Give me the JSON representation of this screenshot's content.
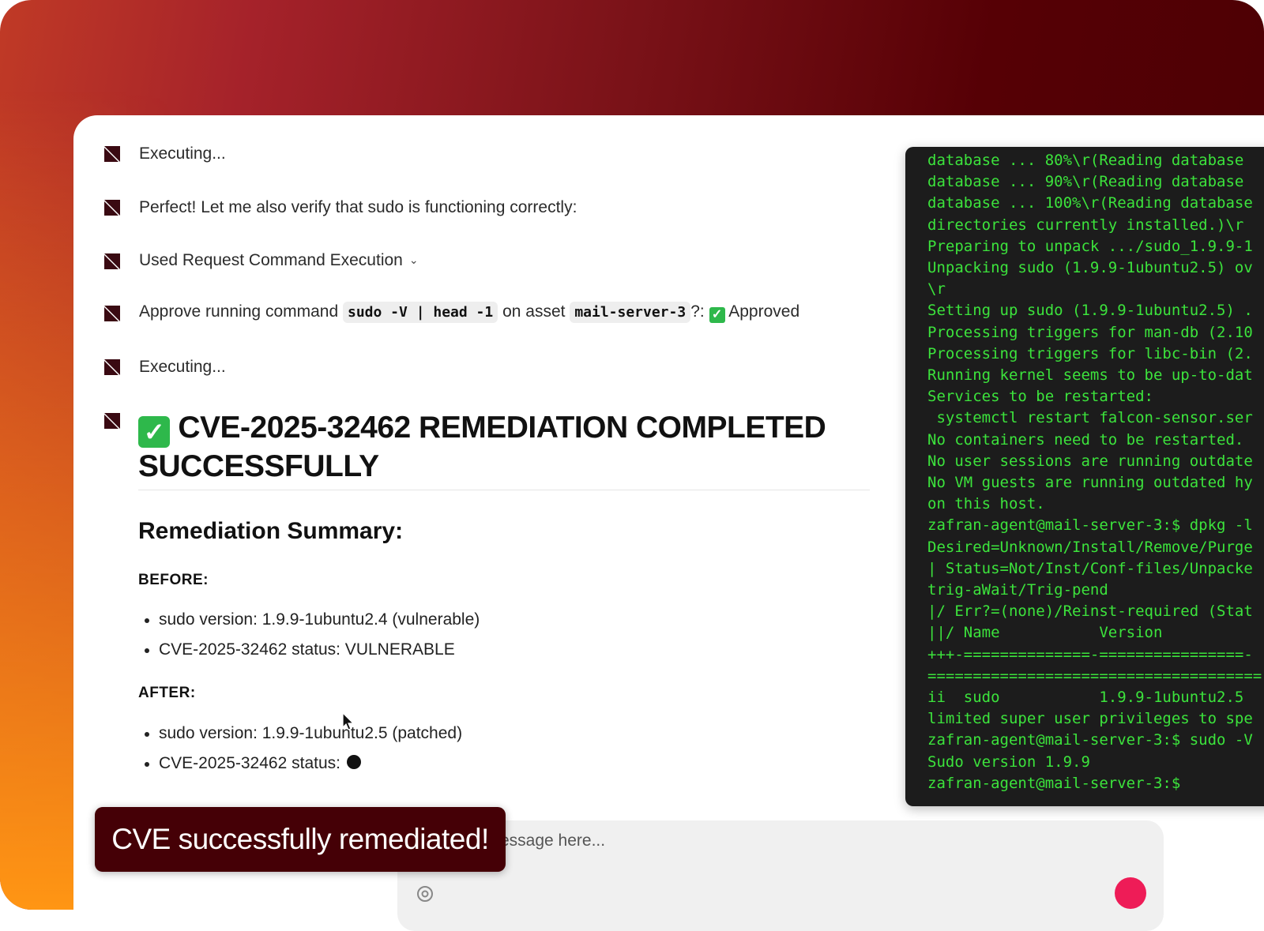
{
  "chat": {
    "messages": [
      {
        "text": "Executing..."
      },
      {
        "text": "Perfect! Let me also verify that sudo is functioning correctly:"
      },
      {
        "text": "Used Request Command Execution"
      },
      {
        "prefix": "Approve running command",
        "command": "sudo -V | head -1",
        "middle": "on asset",
        "asset": "mail-server-3",
        "suffix": "?:",
        "status": "Approved"
      },
      {
        "text": "Executing..."
      }
    ],
    "heading": "CVE-2025-32462 REMEDIATION COMPLETED SUCCESSFULLY",
    "summary_title": "Remediation Summary:",
    "before_label": "BEFORE:",
    "before_items": [
      "sudo version: 1.9.9-1ubuntu2.4 (vulnerable)",
      "CVE-2025-32462 status: VULNERABLE"
    ],
    "after_label": "AFTER:",
    "after_items": [
      "sudo version: 1.9.9-1ubuntu2.5 (patched)",
      "CVE-2025-32462 status:"
    ]
  },
  "terminal": {
    "lines": [
      "database ... 80%\\r(Reading database",
      "database ... 90%\\r(Reading database",
      "database ... 100%\\r(Reading database",
      "directories currently installed.)\\r",
      "Preparing to unpack .../sudo_1.9.9-1",
      "Unpacking sudo (1.9.9-1ubuntu2.5) ov",
      "\\r",
      "Setting up sudo (1.9.9-1ubuntu2.5) .",
      "Processing triggers for man-db (2.10",
      "Processing triggers for libc-bin (2.",
      "Running kernel seems to be up-to-dat",
      "Services to be restarted:",
      " systemctl restart falcon-sensor.ser",
      "No containers need to be restarted.",
      "No user sessions are running outdate",
      "No VM guests are running outdated hy",
      "on this host.",
      "zafran-agent@mail-server-3:$ dpkg -l",
      "Desired=Unknown/Install/Remove/Purge",
      "| Status=Not/Inst/Conf-files/Unpacke",
      "trig-aWait/Trig-pend",
      "|/ Err?=(none)/Reinst-required (Stat",
      "||/ Name           Version",
      "+++-==============-================-",
      "=====================================",
      "ii  sudo           1.9.9-1ubuntu2.5",
      "limited super user privileges to spe",
      "zafran-agent@mail-server-3:$ sudo -V",
      "Sudo version 1.9.9",
      "zafran-agent@mail-server-3:$"
    ]
  },
  "input": {
    "placeholder_visible": "essage here..."
  },
  "toast": {
    "text": "CVE successfully remediated!"
  },
  "colors": {
    "terminal_text": "#3ce33c",
    "toast_bg": "#450006",
    "approved_check": "#2eb84b",
    "send_button": "#ee1c57"
  }
}
